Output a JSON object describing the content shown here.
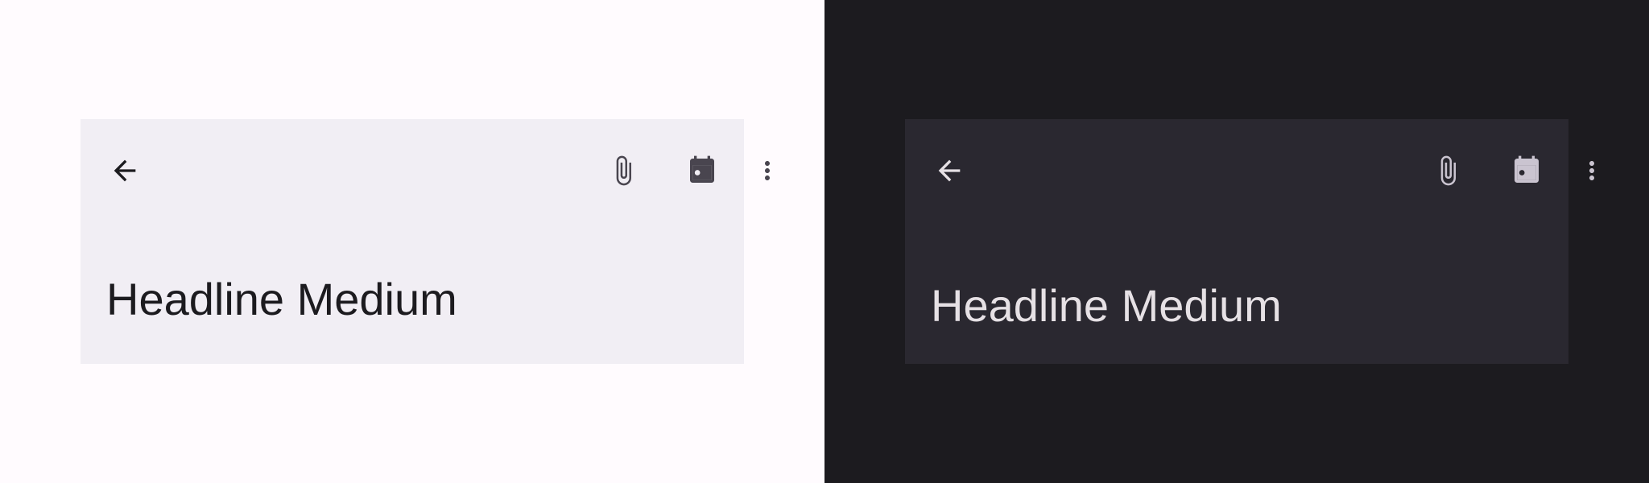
{
  "theme_colors": {
    "light_background": "#fffbfe",
    "light_surface": "#f1eef4",
    "light_on_surface": "#1c1b1f",
    "dark_background": "#1c1b1f",
    "dark_surface": "#2a2830",
    "dark_on_surface": "#e6e1e5"
  },
  "panels": [
    {
      "theme": "light",
      "navigation_icon": "arrow-back-icon",
      "actions": [
        "attach-file-icon",
        "event-icon",
        "more-vert-icon"
      ],
      "headline": "Headline Medium"
    },
    {
      "theme": "dark",
      "navigation_icon": "arrow-back-icon",
      "actions": [
        "attach-file-icon",
        "event-icon",
        "more-vert-icon"
      ],
      "headline": "Headline Medium"
    }
  ]
}
